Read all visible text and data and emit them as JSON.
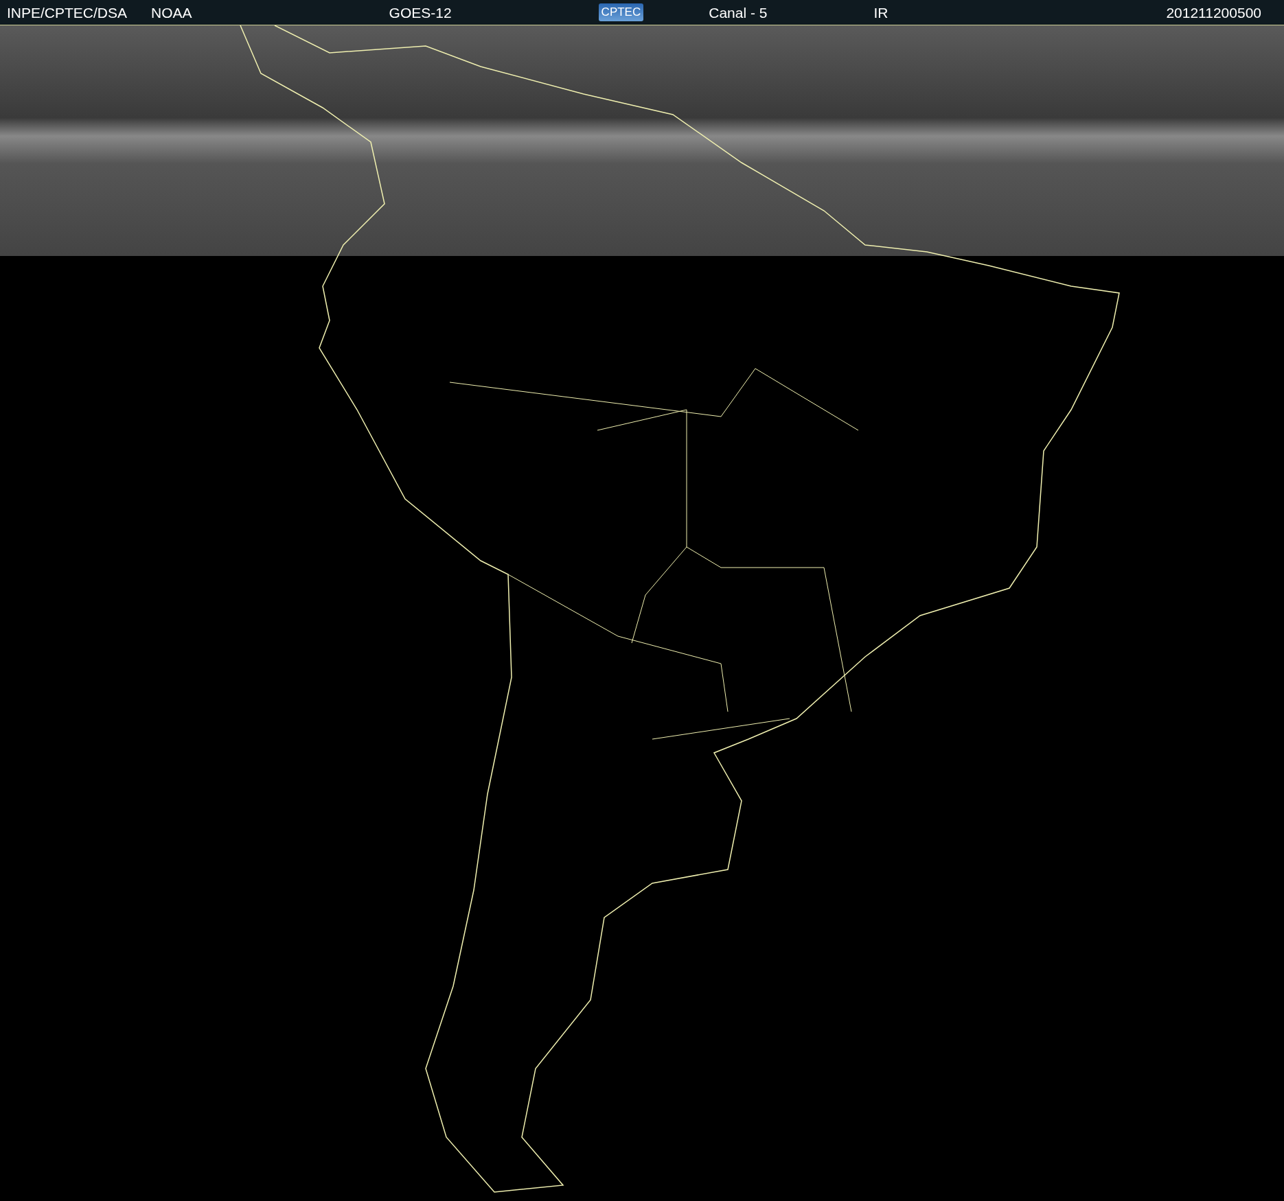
{
  "header": {
    "source": "INPE/CPTEC/DSA",
    "agency": "NOAA",
    "satellite": "GOES-12",
    "logo": "CPTEC",
    "channel": "Canal - 5",
    "band": "IR",
    "timestamp": "201211200500"
  }
}
